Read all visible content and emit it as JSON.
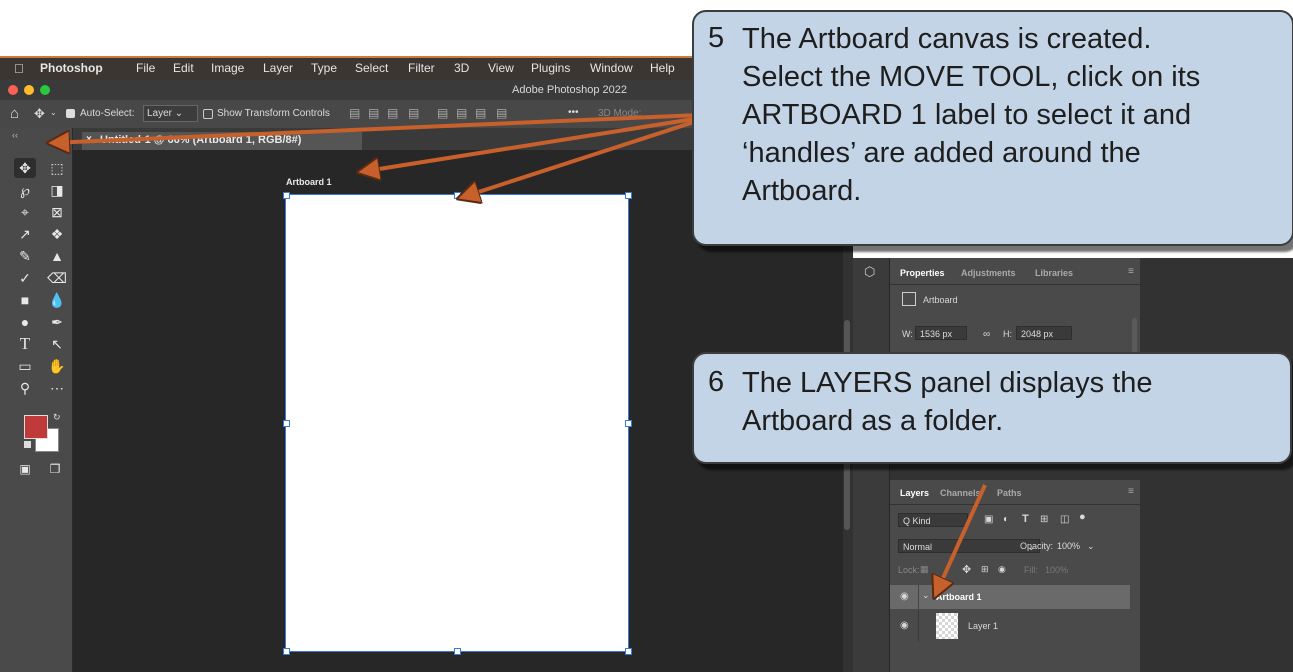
{
  "menubar": {
    "apple_icon": "apple-icon",
    "items": [
      "Photoshop",
      "File",
      "Edit",
      "Image",
      "Layer",
      "Type",
      "Select",
      "Filter",
      "3D",
      "View",
      "Plugins",
      "Window",
      "Help"
    ]
  },
  "titlebar": {
    "title": "Adobe Photoshop 2022"
  },
  "optionsbar": {
    "auto_select_label": "Auto-Select:",
    "auto_select_value": "Layer",
    "show_transform_label": "Show Transform Controls",
    "more": "•••",
    "mode_3d": "3D Mode:"
  },
  "document": {
    "tab_title": "Untitled-1 @ 66% (Artboard 1, RGB/8#)",
    "artboard_label": "Artboard 1"
  },
  "colors": {
    "foreground": "#c0393b",
    "background": "#ffffff",
    "accent": "#3a7bd5",
    "callout": "#c3d4e6",
    "arrow": "#c8602c"
  },
  "properties": {
    "tabs": [
      "Properties",
      "Adjustments",
      "Libraries"
    ],
    "type_label": "Artboard",
    "w_label": "W:",
    "w_value": "1536 px",
    "h_label": "H:",
    "h_value": "2048 px"
  },
  "layers": {
    "tabs": [
      "Layers",
      "Channels",
      "Paths"
    ],
    "filter_kind": "Q Kind",
    "blend_mode": "Normal",
    "opacity_label": "Opacity:",
    "opacity_value": "100%",
    "lock_label": "Lock:",
    "fill_label": "Fill:",
    "fill_value": "100%",
    "rows": [
      {
        "name": "Artboard 1",
        "selected": true
      },
      {
        "name": "Layer 1",
        "selected": false
      }
    ]
  },
  "callout_5": {
    "number": "5",
    "lines": [
      "The Artboard canvas is created.",
      "Select the MOVE TOOL, click on its",
      "ARTBOARD 1 label to select it and",
      "‘handles’ are added around the",
      "Artboard."
    ]
  },
  "callout_6": {
    "number": "6",
    "lines": [
      "The LAYERS panel displays the",
      "Artboard as a folder."
    ]
  }
}
